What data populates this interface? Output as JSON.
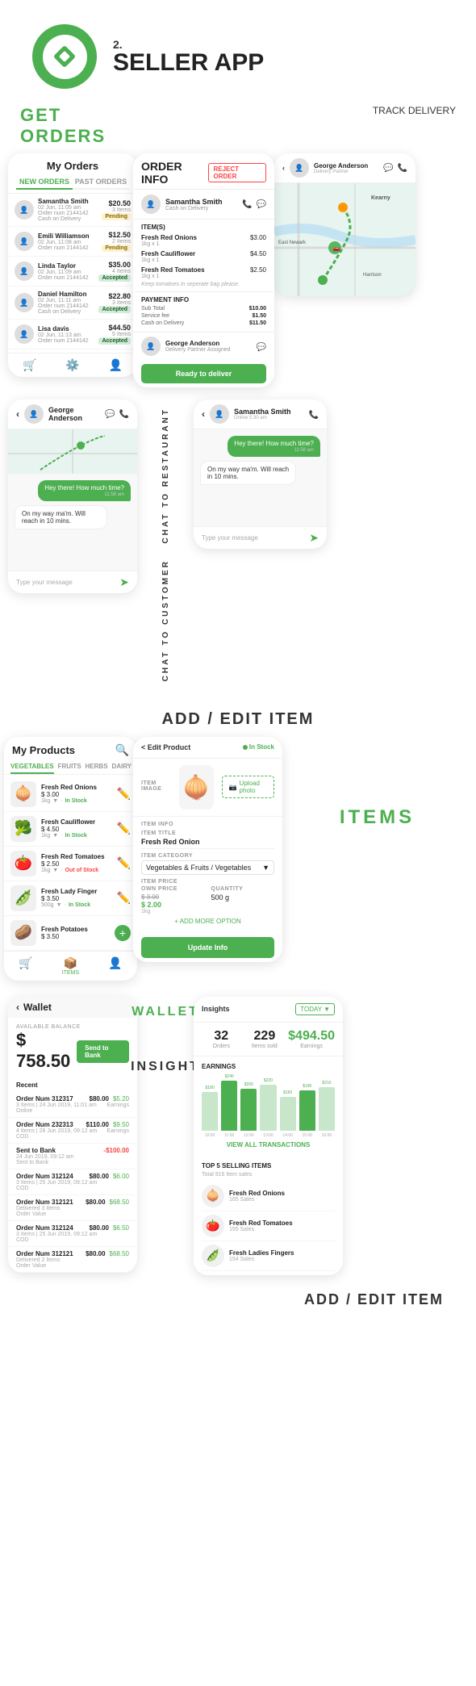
{
  "header": {
    "number": "2.",
    "title": "SELLER APP"
  },
  "sections": {
    "get_orders": "GET ORDERS",
    "track_delivery": "TRACK DELIVERY",
    "chat_to_restaurant": "CHAT TO RESTAURANT",
    "chat_to_customer": "CHAT TO CUSTOMER",
    "add_edit_item": "ADD / EDIT ITEM",
    "items": "ITEMS",
    "wallet": "WALLET",
    "insight": "INSIGHT"
  },
  "my_orders": {
    "title": "My Orders",
    "tabs": [
      "NEW ORDERS",
      "PAST ORDERS"
    ],
    "orders": [
      {
        "name": "Samantha Smith",
        "date": "02 Jun, 11:05 am",
        "num": "Order num 2144142",
        "items": "3 Items",
        "price": "$20.50",
        "status": "Pending",
        "type": "Cash on Delivery"
      },
      {
        "name": "Emili Williamson",
        "date": "02 Jun, 11:08 am",
        "num": "Order num 2144142",
        "items": "2 Items",
        "price": "$12.50",
        "status": "Pending",
        "type": ""
      },
      {
        "name": "Linda Taylor",
        "date": "02 Jun, 11:09 am",
        "num": "Order num 2144142",
        "items": "4 Items",
        "price": "$35.00",
        "status": "Accepted",
        "type": ""
      },
      {
        "name": "Daniel Hamilton",
        "date": "02 Jun, 11:11 am",
        "num": "Order num 2144142",
        "items": "3 Items",
        "price": "$22.80",
        "status": "Accepted",
        "type": "Cash on Delivery"
      },
      {
        "name": "Lisa davis",
        "date": "02 Jun, 11:13 am",
        "num": "Order num 2144142",
        "items": "5 Items",
        "price": "$44.50",
        "status": "Accepted",
        "type": ""
      }
    ]
  },
  "order_info": {
    "title": "ORDER INFO",
    "reject_btn": "REJECT ORDER",
    "customer": "Samantha Smith",
    "customer_note": "Cash on Delivery",
    "items_label": "ITEM(S)",
    "items": [
      {
        "name": "Fresh Red Onions",
        "qty": "1kg x 1",
        "price": "$3.00"
      },
      {
        "name": "Fresh Cauliflower",
        "qty": "1kg x 1",
        "price": "$4.50"
      },
      {
        "name": "Fresh Red Tomatoes",
        "qty": "1kg x 1",
        "price": "$2.50"
      }
    ],
    "note": "Keep tomatoes in seperate bag please.",
    "payment_label": "PAYMENT INFO",
    "payment": [
      {
        "key": "Sub Total",
        "value": "$10.00"
      },
      {
        "key": "Service fee",
        "value": "$1.50"
      },
      {
        "key": "Cash on Delivery",
        "value": "$11.50"
      }
    ],
    "driver": "George Anderson",
    "driver_role": "Delivery Partner Assigned",
    "ready_btn": "Ready to deliver"
  },
  "track_delivery": {
    "driver": "George Anderson",
    "locations": [
      "Kearny",
      "East Newark",
      "Harrison"
    ]
  },
  "chat_restaurant": {
    "name": "George Anderson",
    "bubble1": "Hey there! How much time?",
    "time1": "11:58 am",
    "reply1": "On my way ma'm. Will reach in 10 mins.",
    "input_placeholder": "Type your message"
  },
  "chat_customer": {
    "name": "Samantha Smith",
    "bubble1": "Hey there! How much time?",
    "time1": "11:58 am",
    "reply1": "On my way ma'm. Will reach in 10 mins.",
    "input_placeholder": "Type your message"
  },
  "my_products": {
    "title": "My Products",
    "categories": [
      "VEGETABLES",
      "FRUITS",
      "HERBS",
      "DAIRY"
    ],
    "products": [
      {
        "name": "Fresh Red Onions",
        "price": "$ 3.00",
        "qty": "1kg",
        "stock": "In Stock",
        "in_stock": true,
        "emoji": "🧅"
      },
      {
        "name": "Fresh Cauliflower",
        "price": "$ 4.50",
        "qty": "1kg",
        "stock": "In Stock",
        "in_stock": true,
        "emoji": "🥦"
      },
      {
        "name": "Fresh Red Tomatoes",
        "price": "$ 2.50",
        "qty": "1kg",
        "stock": "Out of Stock",
        "in_stock": false,
        "emoji": "🍅"
      },
      {
        "name": "Fresh Lady Finger",
        "price": "$ 3.50",
        "qty": "500g",
        "stock": "In Stock",
        "in_stock": true,
        "emoji": "🫛"
      },
      {
        "name": "Fresh Potatoes",
        "price": "$ 3.50",
        "qty": "",
        "stock": "",
        "in_stock": true,
        "emoji": "🥔"
      }
    ],
    "nav": [
      "orders",
      "settings",
      "user"
    ]
  },
  "edit_product": {
    "back_label": "< Edit Product",
    "stock_label": "In Stock",
    "item_image_label": "ITEM IMAGE",
    "upload_label": "Upload photo",
    "item_info_label": "ITEM INFO",
    "title_label": "ITEM TITLE",
    "title_value": "Fresh Red Onion",
    "category_label": "ITEM CATEGORY",
    "category_value": "Vegetables & Fruits / Vegetables",
    "price_label": "ITEM PRICE",
    "own_price_label": "OWN PRICE",
    "quantity_label": "QUANTITY",
    "price_original": "$ 3.00",
    "price_sale": "$ 2.00",
    "qty1": "1kg",
    "qty2": "500 g",
    "add_more": "+ ADD MORE OPTION",
    "update_btn": "Update Info",
    "emoji": "🧅"
  },
  "wallet": {
    "title": "Wallet",
    "available_label": "AVAILABLE BALANCE",
    "balance": "$ 758.50",
    "send_bank_btn": "Send to Bank",
    "recent_label": "Recent",
    "transactions": [
      {
        "num": "Order Num 312317",
        "date": "3 Items | 24 Jun 2019, 11:01 am",
        "price": "$80.00",
        "type": "Online",
        "earnings": "$5.20",
        "earnings_label": "Earnings"
      },
      {
        "num": "Order Num 232313",
        "date": "4 Items | 28 Jun 2019, 09:12 am",
        "price": "$110.00",
        "type": "COD",
        "earnings": "$9.50",
        "earnings_label": "Earnings"
      },
      {
        "num": "Sent to Bank",
        "date": "24 Jun 2019, 09:12 am",
        "price": "-$100.00",
        "type": "Sent to Bank",
        "earnings": "",
        "negative": true
      },
      {
        "num": "Order Num 312124",
        "date": "3 Items | 25 Jun 2019, 09:12 am",
        "price": "$80.00",
        "type": "COD",
        "earnings": "$6.00",
        "earnings_label": "Earnings"
      },
      {
        "num": "Order Num 312121",
        "date": "Delivered 3 Items",
        "price": "$80.00",
        "type": "Order Value",
        "earnings": "$68.50",
        "earnings_label": "Earnings"
      },
      {
        "num": "Order Num 312124",
        "date": "3 Items | 25 Jun 2019, 09:12 am",
        "price": "$80.00",
        "type": "COD",
        "earnings": "$6.50",
        "earnings_label": "Earnings"
      },
      {
        "num": "Order Num 312121",
        "date": "Delivered 2 Items",
        "price": "$80.00",
        "type": "Order Value",
        "earnings": "$68.50",
        "earnings_label": "Earnings"
      }
    ]
  },
  "insights": {
    "title": "Insights",
    "today_label": "TODAY",
    "orders_label": "Orders",
    "items_sold_label": "Items sold",
    "earnings_label": "Earnings",
    "orders_count": "32",
    "items_sold": "229",
    "earnings": "$494.50",
    "earnings_section": "EARNINGS",
    "chart_times": [
      "10:00",
      "11:00",
      "12:00",
      "13:00",
      "14:00",
      "15:00",
      "16:00"
    ],
    "chart_values": [
      180,
      240,
      200,
      220,
      160,
      190,
      210
    ],
    "chart_max": 250,
    "view_all": "VIEW ALL TRANSACTIONS",
    "top5_label": "TOP 5 SELLING ITEMS",
    "top5_sub": "Total 916 Item sales",
    "top5_items": [
      {
        "name": "Fresh Red Onions",
        "sales": "165 Sales",
        "emoji": "🧅"
      },
      {
        "name": "Fresh Red Tomatoes",
        "sales": "155 Sales",
        "emoji": "🍅"
      },
      {
        "name": "Fresh Ladies Fingers",
        "sales": "154 Sales",
        "emoji": "🫛"
      }
    ]
  }
}
